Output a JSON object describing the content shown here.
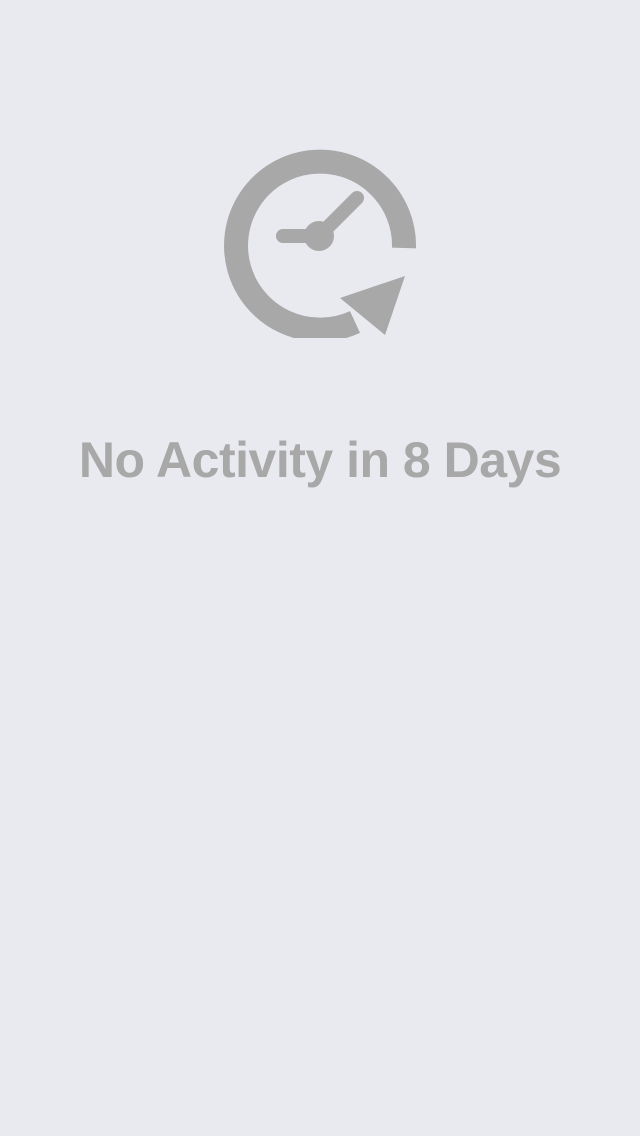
{
  "empty_state": {
    "icon": "clock-refresh-icon",
    "message": "No Activity in 8 Days"
  },
  "colors": {
    "background": "#e9eaf0",
    "icon_and_text": "#a8a8a8"
  }
}
